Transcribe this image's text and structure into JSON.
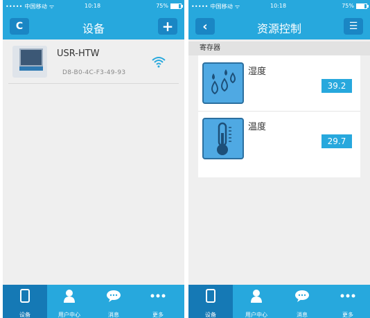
{
  "status_bar": {
    "carrier": "••••• 中国移动 ᯤ",
    "time": "10:18",
    "battery": "75%"
  },
  "left_screen": {
    "nav_title": "设备",
    "refresh_label": "C",
    "add_label": "+",
    "device": {
      "name": "USR-HTW",
      "mac": "D8-B0-4C-F3-49-93"
    }
  },
  "right_screen": {
    "nav_title": "资源控制",
    "back_label": "‹",
    "menu_label": "☰",
    "section_header": "寄存器",
    "resources": [
      {
        "name": "湿度",
        "value": "39.2",
        "icon": "humidity-icon"
      },
      {
        "name": "温度",
        "value": "29.7",
        "icon": "thermometer-icon"
      }
    ]
  },
  "tabbar": {
    "tabs": [
      {
        "label": "设备",
        "icon": "phone-icon"
      },
      {
        "label": "用户中心",
        "icon": "user-icon"
      },
      {
        "label": "消息",
        "icon": "message-icon"
      },
      {
        "label": "更多",
        "icon": "more-icon"
      }
    ]
  },
  "colors": {
    "accent": "#27a8dd",
    "accent_dark": "#1579b5",
    "background": "#efefef"
  }
}
